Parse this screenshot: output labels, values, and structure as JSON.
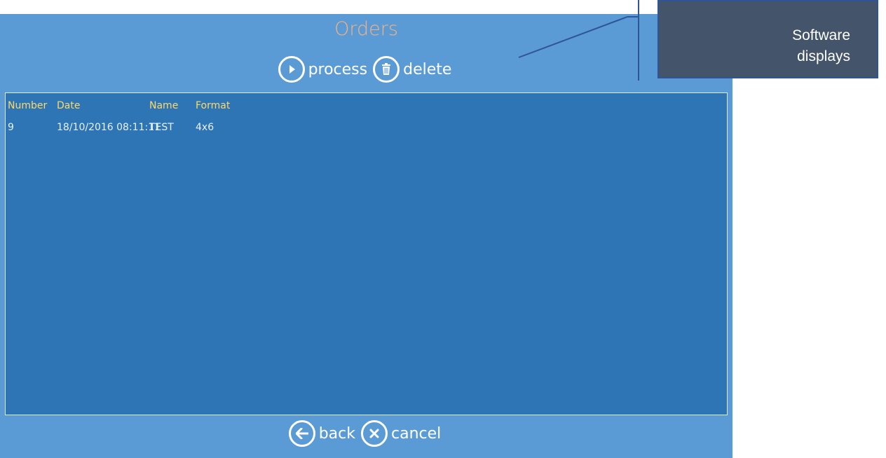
{
  "window": {
    "title": "Orders"
  },
  "toolbar": {
    "process_label": "process",
    "delete_label": "delete",
    "back_label": "back",
    "cancel_label": "cancel"
  },
  "table": {
    "columns": [
      "Number",
      "Date",
      "Name",
      "Format"
    ],
    "rows": [
      {
        "number": "9",
        "date": "18/10/2016 08:11:11",
        "name": "TEST",
        "format": "4x6"
      }
    ]
  },
  "callout": {
    "line1": "Software",
    "line2": "displays"
  },
  "colors": {
    "panel": "#5b9bd5",
    "list": "#2e75b6",
    "title": "#f4b183",
    "header_text": "#ffd966",
    "callout": "#44546a"
  },
  "icons": [
    "play-icon",
    "trash-icon",
    "back-arrow-icon",
    "close-icon"
  ]
}
